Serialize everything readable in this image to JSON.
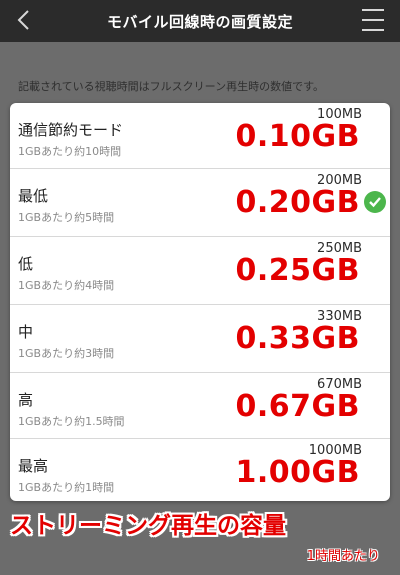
{
  "header": {
    "title": "モバイル回線時の画質設定"
  },
  "notice": "記載されている視聴時間はフルスクリーン再生時の数値です。",
  "options": [
    {
      "label": "通信節約モード",
      "sub": "1GBあたり約10時間",
      "mb": "100MB",
      "gb": "0.10GB",
      "selected": false
    },
    {
      "label": "最低",
      "sub": "1GBあたり約5時間",
      "mb": "200MB",
      "gb": "0.20GB",
      "selected": true
    },
    {
      "label": "低",
      "sub": "1GBあたり約4時間",
      "mb": "250MB",
      "gb": "0.25GB",
      "selected": false
    },
    {
      "label": "中",
      "sub": "1GBあたり約3時間",
      "mb": "330MB",
      "gb": "0.33GB",
      "selected": false
    },
    {
      "label": "高",
      "sub": "1GBあたり約1.5時間",
      "mb": "670MB",
      "gb": "0.67GB",
      "selected": false
    },
    {
      "label": "最高",
      "sub": "1GBあたり約1時間",
      "mb": "1000MB",
      "gb": "1.00GB",
      "selected": false
    }
  ],
  "caption": {
    "main": "ストリーミング再生の容量",
    "sub": "1時間あたり"
  },
  "colors": {
    "accent_red": "#e30000",
    "check_green": "#4cb64c",
    "topbar": "#2b2b2b"
  },
  "icons": {
    "back": "chevron-left-icon",
    "menu": "hamburger-menu-icon",
    "selected": "check-circle-icon"
  }
}
